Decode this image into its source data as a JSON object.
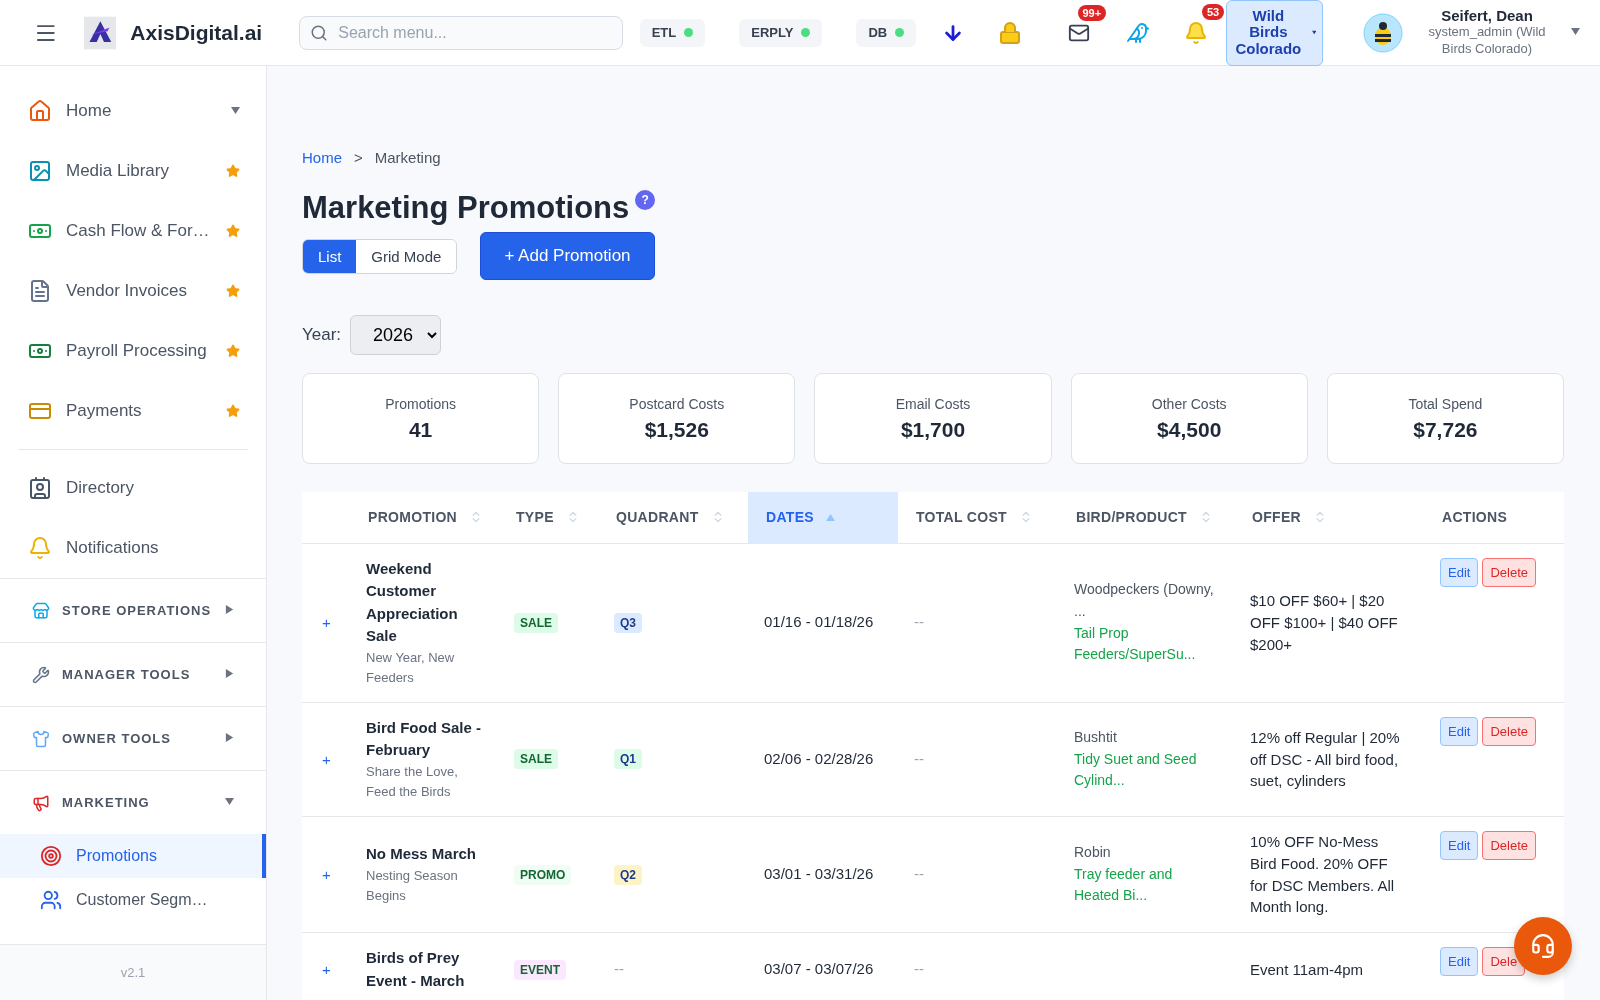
{
  "header": {
    "brand": "AxisDigital.ai",
    "search": {
      "placeholder": "Search menu..."
    },
    "statuses": [
      {
        "label": "ETL",
        "online": true
      },
      {
        "label": "ERPLY",
        "online": true
      },
      {
        "label": "DB",
        "online": true
      }
    ],
    "mail_badge": "99+",
    "bell_badge": "53",
    "store": "Wild Birds Colorado",
    "user": {
      "name": "Seifert, Dean",
      "role": "system_admin (Wild Birds Colorado)"
    }
  },
  "sidebar": {
    "items": [
      {
        "label": "Home",
        "kind": "caret"
      },
      {
        "label": "Media Library",
        "kind": "star"
      },
      {
        "label": "Cash Flow & For…",
        "kind": "star"
      },
      {
        "label": "Vendor Invoices",
        "kind": "star"
      },
      {
        "label": "Payroll Processing",
        "kind": "star"
      },
      {
        "label": "Payments",
        "kind": "star"
      }
    ],
    "items_2": [
      {
        "label": "Directory"
      },
      {
        "label": "Notifications"
      }
    ],
    "sections": [
      {
        "label": "STORE OPERATIONS",
        "expanded": false
      },
      {
        "label": "MANAGER TOOLS",
        "expanded": false
      },
      {
        "label": "OWNER TOOLS",
        "expanded": false
      },
      {
        "label": "MARKETING",
        "expanded": true,
        "children": [
          {
            "label": "Promotions",
            "selected": true
          },
          {
            "label": "Customer Segm…",
            "selected": false
          }
        ]
      }
    ],
    "version": "v2.1"
  },
  "breadcrumb": [
    {
      "label": "Home",
      "link": true
    },
    {
      "label": ">",
      "link": false
    },
    {
      "label": "Marketing",
      "link": false
    }
  ],
  "title": "Marketing Promotions",
  "help": "?",
  "view_modes": [
    {
      "label": "List",
      "selected": true
    },
    {
      "label": "Grid Mode",
      "selected": false
    }
  ],
  "add_button": "+ Add Promotion",
  "year": {
    "label": "Year:",
    "value": "2026"
  },
  "stats": [
    {
      "label": "Promotions",
      "value": "41"
    },
    {
      "label": "Postcard Costs",
      "value": "$1,526"
    },
    {
      "label": "Email Costs",
      "value": "$1,700"
    },
    {
      "label": "Other Costs",
      "value": "$4,500"
    },
    {
      "label": "Total Spend",
      "value": "$7,726"
    }
  ],
  "table": {
    "columns": [
      {
        "label": "PROMOTION",
        "sortable": true,
        "sorted": false
      },
      {
        "label": "TYPE",
        "sortable": true,
        "sorted": false
      },
      {
        "label": "QUADRANT",
        "sortable": true,
        "sorted": false
      },
      {
        "label": "DATES",
        "sortable": true,
        "sorted": true
      },
      {
        "label": "TOTAL COST",
        "sortable": true,
        "sorted": false
      },
      {
        "label": "BIRD/PRODUCT",
        "sortable": true,
        "sorted": false
      },
      {
        "label": "OFFER",
        "sortable": true,
        "sorted": false
      },
      {
        "label": "ACTIONS",
        "sortable": false,
        "sorted": false
      }
    ],
    "rows": [
      {
        "expander": "+",
        "name": "Weekend Customer Appreciation Sale",
        "subtitle": "New Year, New Feeders",
        "type": {
          "label": "SALE",
          "color": "#dcfce7"
        },
        "quadrant": {
          "label": "Q3",
          "color": "#dbeafe"
        },
        "dates": "01/16 - 01/18/26",
        "total_cost": "--",
        "bird": "Woodpeckers (Downy, ...",
        "product": "Tail Prop Feeders/SuperSu...",
        "offer": "$10 OFF $60+ | $20 OFF $100+ | $40 OFF $200+",
        "actions": [
          "Edit",
          "Delete"
        ]
      },
      {
        "expander": "+",
        "name": "Bird Food Sale - February",
        "subtitle": "Share the Love, Feed the Birds",
        "type": {
          "label": "SALE",
          "color": "#dcfce7"
        },
        "quadrant": {
          "label": "Q1",
          "color": "#dcfce7"
        },
        "dates": "02/06 - 02/28/26",
        "total_cost": "--",
        "bird": "Bushtit",
        "product": "Tidy Suet and Seed Cylind...",
        "offer": "12% off Regular | 20% off DSC - All bird food, suet, cylinders",
        "actions": [
          "Edit",
          "Delete"
        ]
      },
      {
        "expander": "+",
        "name": "No Mess March",
        "subtitle": "Nesting Season Begins",
        "type": {
          "label": "PROMO",
          "color": "#f0fdf4"
        },
        "quadrant": {
          "label": "Q2",
          "color": "#fef3c7"
        },
        "dates": "03/01 - 03/31/26",
        "total_cost": "--",
        "bird": "Robin",
        "product": "Tray feeder and Heated Bi...",
        "offer": "10% OFF No-Mess Bird Food. 20% OFF for DSC Members. All Month long.",
        "actions": [
          "Edit",
          "Delete"
        ]
      },
      {
        "expander": "+",
        "name": "Birds of Prey Event - March",
        "type": {
          "label": "EVENT",
          "color": "#fae8ff"
        },
        "quadrant": {
          "label": "--"
        },
        "dates": "03/07 - 03/07/26",
        "total_cost": "--",
        "offer": "Event 11am-4pm",
        "actions": [
          "Edit",
          "Dele"
        ]
      }
    ]
  }
}
